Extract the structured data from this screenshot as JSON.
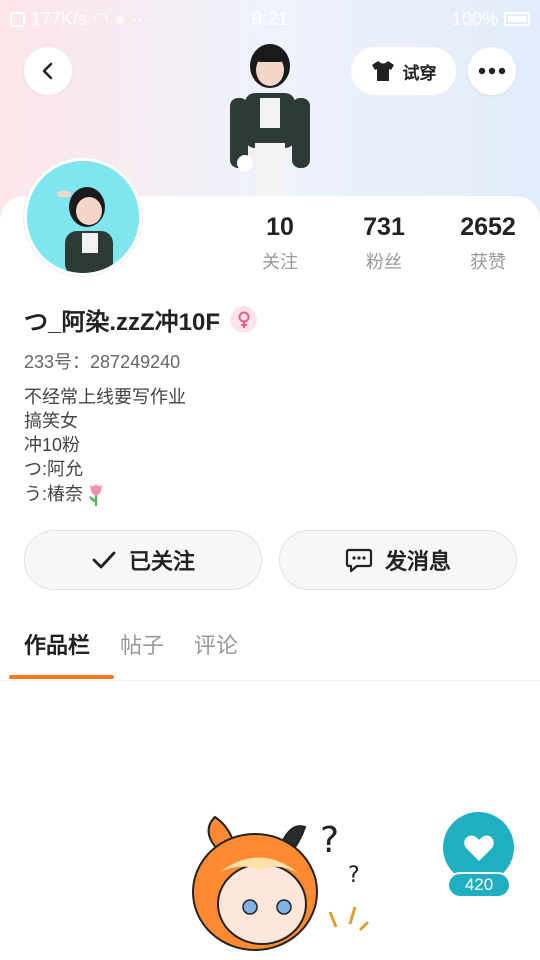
{
  "status_bar": {
    "network_speed": "177K/s",
    "time": "9:21",
    "battery": "100%"
  },
  "header": {
    "back_icon": "chevron-left-icon",
    "tryon_label": "试穿",
    "tryon_icon": "tshirt-icon",
    "more_icon": "more-dots-icon"
  },
  "profile": {
    "stats": [
      {
        "value": "10",
        "label": "关注"
      },
      {
        "value": "731",
        "label": "粉丝"
      },
      {
        "value": "2652",
        "label": "获赞"
      }
    ],
    "username": "つ_阿染.zzZ冲10F",
    "gender_icon": "female-icon",
    "uid": "233号：287249240",
    "bio": [
      "不经常上线要写作业",
      "搞笑女",
      "冲10粉",
      "つ:阿允",
      "う:椿奈"
    ]
  },
  "actions": {
    "follow_label": "已关注",
    "message_label": "发消息"
  },
  "tabs": [
    {
      "label": "作品栏",
      "active": true
    },
    {
      "label": "帖子",
      "active": false
    },
    {
      "label": "评论",
      "active": false
    }
  ],
  "works": {
    "like_count": "420"
  },
  "colors": {
    "accent_orange": "#ff7a1f",
    "like_teal": "#1fb0c0",
    "avatar_bg": "#7ee6ef",
    "gender_pink": "#fde3ec"
  }
}
